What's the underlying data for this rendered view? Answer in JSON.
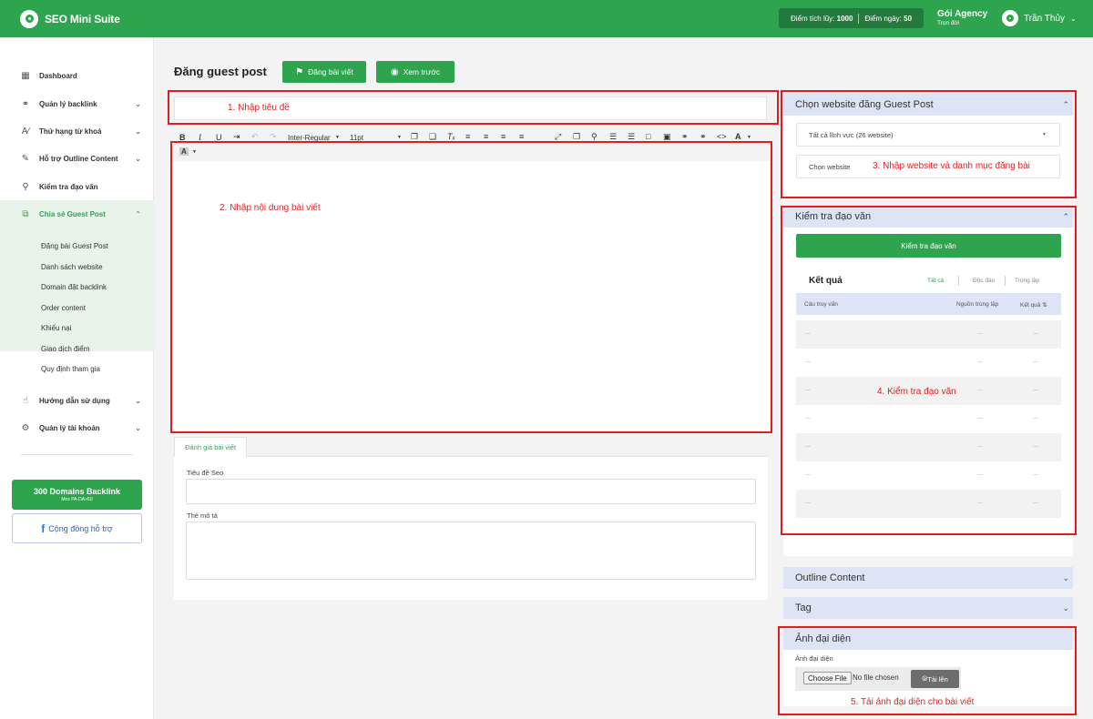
{
  "app": {
    "name": "SEO Mini Suite"
  },
  "header": {
    "points_label": "Điểm tích lũy:",
    "points_value": "1000",
    "daily_label": "Điểm ngày:",
    "daily_value": "50",
    "plan_name": "Gói Agency",
    "plan_sub": "Trọn đời",
    "user_name": "Trần Thủy"
  },
  "sidebar": {
    "items": [
      {
        "label": "Dashboard",
        "icon": "grid-icon"
      },
      {
        "label": "Quản lý backlink",
        "icon": "link-icon"
      },
      {
        "label": "Thứ hạng từ khoá",
        "icon": "ranking-icon"
      },
      {
        "label": "Hỗ trợ Outline Content",
        "icon": "edit-icon"
      },
      {
        "label": "Kiểm tra đạo văn",
        "icon": "search-icon"
      },
      {
        "label": "Chia sẻ Guest Post",
        "icon": "share-icon"
      },
      {
        "label": "Hướng dẫn sử dụng",
        "icon": "guide-icon"
      },
      {
        "label": "Quản lý tài khoản",
        "icon": "account-icon"
      }
    ],
    "submenu": [
      "Đăng bài Guest Post",
      "Danh sách website",
      "Domain đặt backlink",
      "Order content",
      "Khiếu nại",
      "Giao dịch điểm",
      "Quy định tham gia"
    ],
    "promo_title": "300 Domains Backlink",
    "promo_sub": "Moz PA-DA>50",
    "community": "Cộng đồng hỗ trợ"
  },
  "page": {
    "title": "Đăng guest post",
    "publish_button": "Đăng bài viết",
    "preview_button": "Xem trước"
  },
  "editor": {
    "font": "Inter-Regular",
    "size": "11pt",
    "tab": "Đánh giá bài viết",
    "seo_title_label": "Tiêu đề Seo",
    "meta_label": "Thẻ mô tả"
  },
  "annotations": {
    "a1": "1. Nhập tiêu đề",
    "a2": "2. Nhập nội dung bài viết",
    "a3": "3. Nhập website và danh mục đăng bài",
    "a4": "4. Kiểm tra đạo văn",
    "a5": "5. Tải ảnh đại diện cho bài viết"
  },
  "right": {
    "website_panel": {
      "title": "Chọn website đăng Guest Post",
      "category_select": "Tất cả lĩnh vực (26 website)",
      "website_select": "Chọn website"
    },
    "plagiarism_panel": {
      "title": "Kiểm tra đạo văn",
      "check_button": "Kiểm tra đạo văn",
      "result_title": "Kết quả",
      "filters": [
        "Tất cả",
        "Độc đáo",
        "Trùng lặp"
      ],
      "columns": [
        "Câu truy vấn",
        "Nguồn trùng lặp",
        "Kết quả"
      ],
      "rows": [
        [
          "...",
          "...",
          "..."
        ],
        [
          "...",
          "...",
          "..."
        ],
        [
          "...",
          "...",
          "..."
        ],
        [
          "...",
          "...",
          "..."
        ],
        [
          "...",
          "...",
          "..."
        ],
        [
          "...",
          "...",
          "..."
        ],
        [
          "...",
          "...",
          "..."
        ]
      ]
    },
    "outline_panel": {
      "title": "Outline Content"
    },
    "tag_panel": {
      "title": "Tag"
    },
    "image_panel": {
      "title": "Ảnh đại diện",
      "label": "Ảnh đại diện",
      "choose_file": "Choose File",
      "no_file": "No file chosen",
      "upload_button": "Tải lên"
    }
  },
  "colors": {
    "brand": "#2ea44f",
    "annotation": "#e01e1e",
    "panel_header": "#dde4f5"
  }
}
